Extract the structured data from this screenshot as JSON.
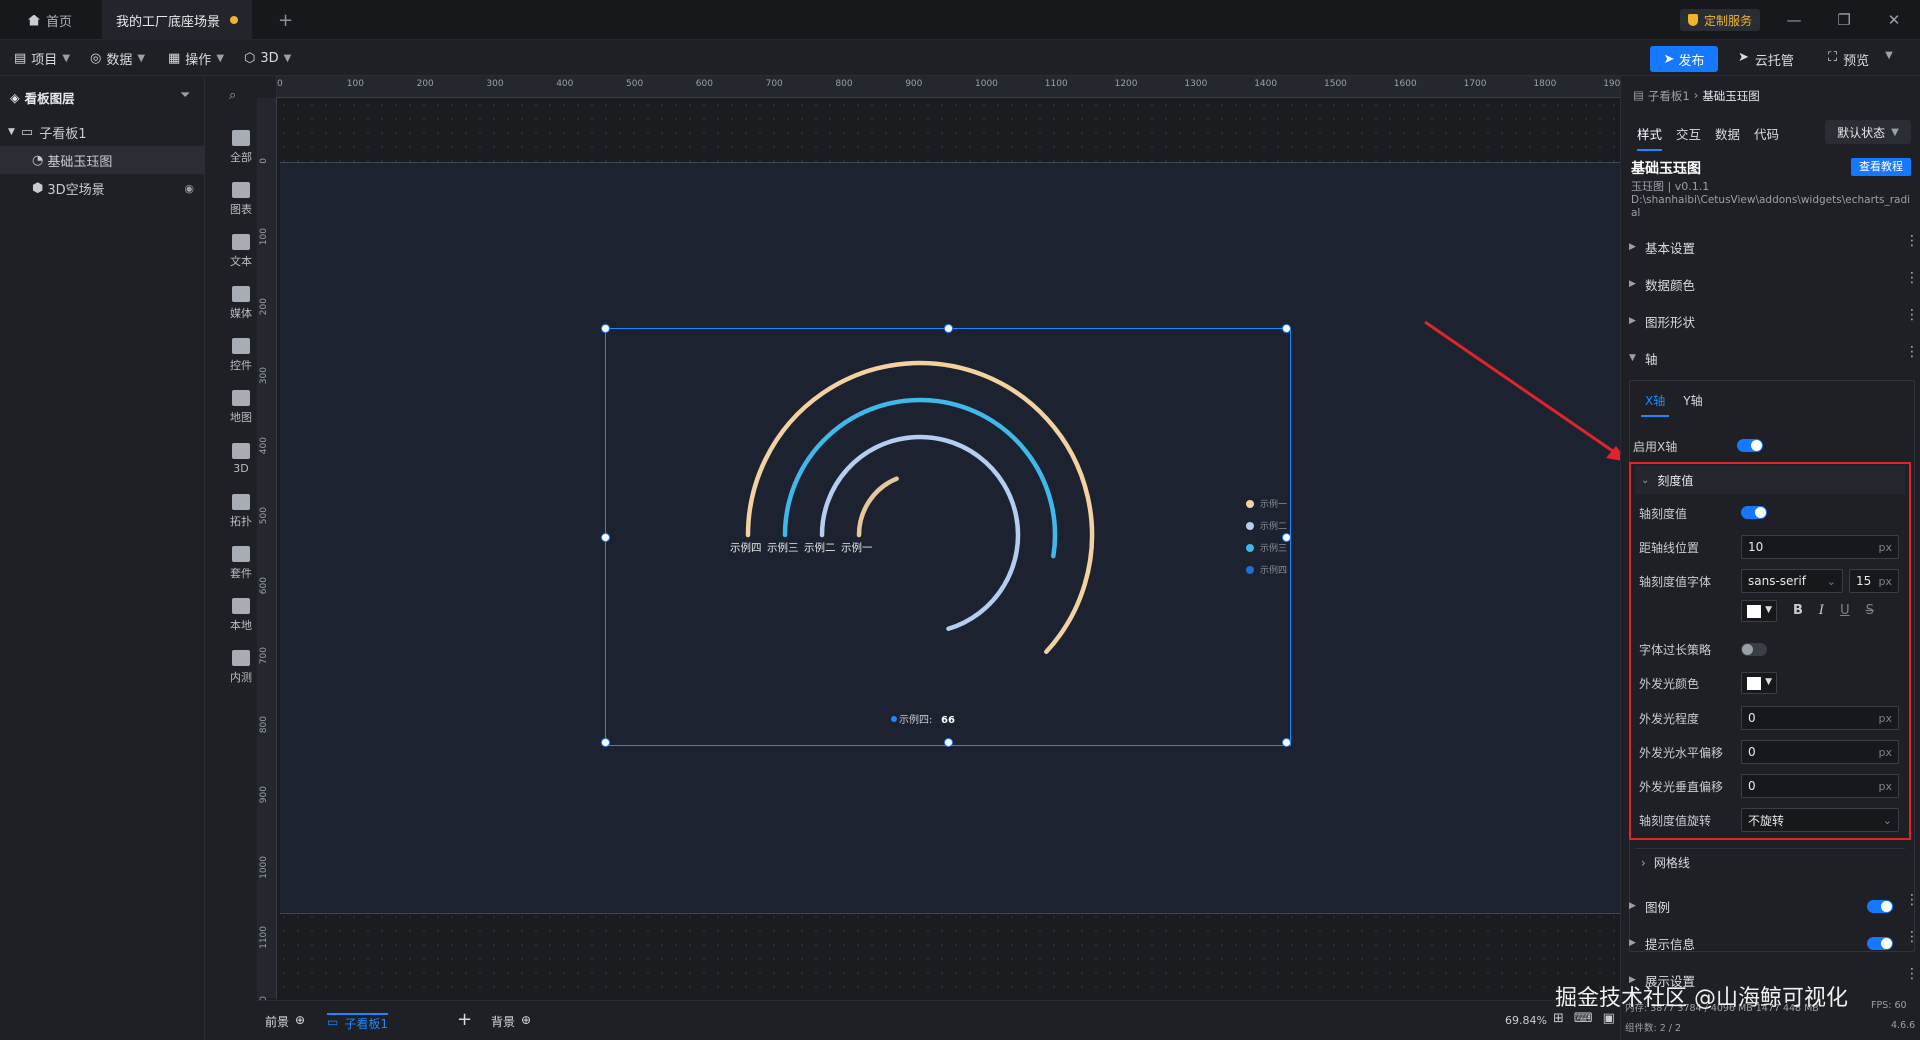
{
  "tabs": [
    {
      "label": "首页",
      "icon": "home-icon"
    },
    {
      "label": "我的工厂底座场景",
      "modified": true
    }
  ],
  "window": {
    "custom_service": "定制服务"
  },
  "menu": [
    {
      "label": "项目",
      "icon": "document-icon"
    },
    {
      "label": "数据",
      "icon": "database-icon"
    },
    {
      "label": "操作",
      "icon": "grid-icon"
    },
    {
      "label": "3D",
      "icon": "cube-icon"
    }
  ],
  "toolbar": {
    "publish": "发布",
    "cloud": "云托管",
    "preview": "预览"
  },
  "layers": {
    "title": "看板图层",
    "items": [
      {
        "label": "子看板1"
      },
      {
        "label": "基础玉珏图"
      },
      {
        "label": "3D空场景"
      }
    ]
  },
  "components": [
    "全部",
    "图表",
    "文本",
    "媒体",
    "控件",
    "地图",
    "3D",
    "拓扑",
    "套件",
    "本地",
    "内测"
  ],
  "ruler": {
    "x_ticks": [
      "0",
      "100",
      "200",
      "300",
      "400",
      "500",
      "600",
      "700",
      "800",
      "900",
      "1000",
      "1100",
      "1200",
      "1300",
      "1400",
      "1500",
      "1600",
      "1700",
      "1800",
      "1900"
    ],
    "y_ticks": [
      "0",
      "100",
      "200",
      "300",
      "400",
      "500",
      "600",
      "700",
      "800",
      "900",
      "1000",
      "1100",
      "1200"
    ]
  },
  "chart": {
    "colors": [
      "#f3d2a2",
      "#3fb8ea",
      "#b5cdf0",
      "#e8c79a"
    ],
    "legend": [
      "示例一",
      "示例二",
      "示例三",
      "示例四"
    ],
    "legend_dots": [
      "#f3d2a2",
      "#b5cdf0",
      "#3fb8ea",
      "#1e6ed8"
    ],
    "ring_labels": [
      "示例四",
      "示例三",
      "示例二",
      "示例一"
    ],
    "tooltip_label": "示例四:",
    "tooltip_value": "66"
  },
  "chart_data": {
    "type": "radial-bar",
    "categories": [
      "示例四",
      "示例三",
      "示例二",
      "示例一"
    ],
    "values": [
      66,
      56,
      75,
      20
    ],
    "max_angle_fraction": 1
  },
  "bottom": {
    "foreground": "前景",
    "board": "子看板1",
    "background": "背景",
    "zoom": "69.84%",
    "memory": "内存: 3877 3784 / 4096 MB  1477 448 MB",
    "fps": "FPS: 60",
    "count": "组件数: 2 / 2",
    "version": "4.6.6"
  },
  "panel": {
    "breadcrumb_parent": "子看板1",
    "breadcrumb_current": "基础玉珏图",
    "tabs": [
      "样式",
      "交互",
      "数据",
      "代码"
    ],
    "state": "默认状态",
    "title": "基础玉珏图",
    "tutorial": "查看教程",
    "subtitle": "玉珏图 | v0.1.1",
    "path": "D:\\shanhaibi\\CetusView\\addons\\widgets\\echarts_radial",
    "sections": [
      "基本设置",
      "数据颜色",
      "图形形状",
      "轴"
    ],
    "axis_tabs": [
      "X轴",
      "Y轴"
    ],
    "enable_x": "启用X轴",
    "tick_section": "刻度值",
    "props": {
      "tick_value": "轴刻度值",
      "distance": "距轴线位置",
      "distance_value": "10",
      "font": "轴刻度值字体",
      "font_family": "sans-serif",
      "font_size": "15",
      "overflow": "字体过长策略",
      "glow_color": "外发光颜色",
      "glow_level": "外发光程度",
      "glow_level_value": "0",
      "glow_x": "外发光水平偏移",
      "glow_x_value": "0",
      "glow_y": "外发光垂直偏移",
      "glow_y_value": "0",
      "rotate": "轴刻度值旋转",
      "rotate_value": "不旋转",
      "unit": "px"
    },
    "grid_line": "网格线",
    "bottom_sections": [
      "图例",
      "提示信息",
      "展示设置"
    ]
  },
  "watermark": "掘金技术社区 @山海鲸可视化"
}
